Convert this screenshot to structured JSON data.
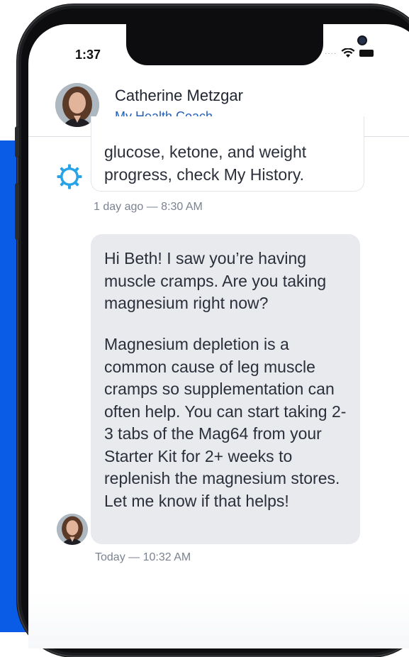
{
  "status_bar": {
    "time": "1:37"
  },
  "header": {
    "coach_name": "Catherine Metzgar",
    "coach_role": "My Health Coach"
  },
  "messages": [
    {
      "text": "glucose, ketone, and weight progress, check My History.",
      "timestamp": "1 day ago — 8:30 AM",
      "sender_icon": "gear-icon"
    },
    {
      "paragraphs": [
        "Hi Beth! I saw you’re having muscle cramps. Are you taking magnesium right now?",
        "Magnesium depletion is a common cause of leg muscle cramps so supplementation can often help. You can start taking 2-3 tabs of the Mag64 from your Starter Kit for 2+ weeks to replenish the magnesium stores. Let me know if that helps!"
      ],
      "timestamp": "Today — 10:32 AM",
      "sender_icon": "avatar"
    }
  ],
  "colors": {
    "accent_blue": "#0a5ce6",
    "link_blue": "#245fb8",
    "bubble_gray": "#e8eaee",
    "gear_blue": "#29a3e8"
  }
}
